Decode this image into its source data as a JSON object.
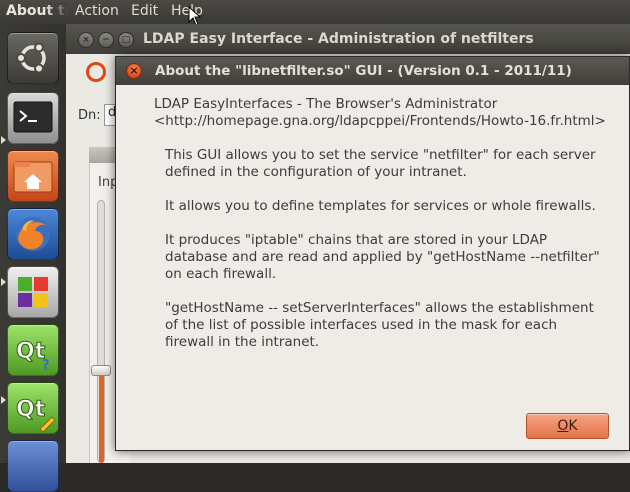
{
  "menubar": {
    "app_title": "About the",
    "menus": [
      "Action",
      "Edit",
      "Help"
    ]
  },
  "launcher": {
    "items": [
      "ubuntu-dash",
      "terminal",
      "home-folder",
      "firefox",
      "applications",
      "qt-creator",
      "qt-designer",
      "more"
    ]
  },
  "background_window": {
    "title": "LDAP Easy Interface - Administration of netfilters",
    "dn_label": "Dn:",
    "dn_value": "d",
    "panel_label": "Inp"
  },
  "dialog": {
    "title": "About the \"libnetfilter.so\" GUI - (Version 0.1 - 2011/11)",
    "header_lines": [
      "LDAP EasyInterfaces - The Browser's Administrator",
      "<http://homepage.gna.org/ldapcppei/Frontends/Howto-16.fr.html>"
    ],
    "paragraphs": [
      [
        "This GUI allows you to set the service \"netfilter\" for each server",
        "defined in the configuration of your intranet."
      ],
      [
        "It allows you to define templates for services or whole firewalls."
      ],
      [
        "It produces \"iptable\" chains that are stored in your LDAP",
        "database and are read and applied by \"getHostName --netfilter\"",
        "on each firewall."
      ],
      [
        "\"getHostName -- setServerInterfaces\" allows the establishment",
        "of the list of possible interfaces used in the mask for each",
        "firewall in the intranet."
      ]
    ],
    "ok_mnemonic": "O",
    "ok_rest": "K"
  },
  "colors": {
    "accent": "#e3734a",
    "titlebar": "#403f3b",
    "dialog_bg": "#efebe6"
  }
}
